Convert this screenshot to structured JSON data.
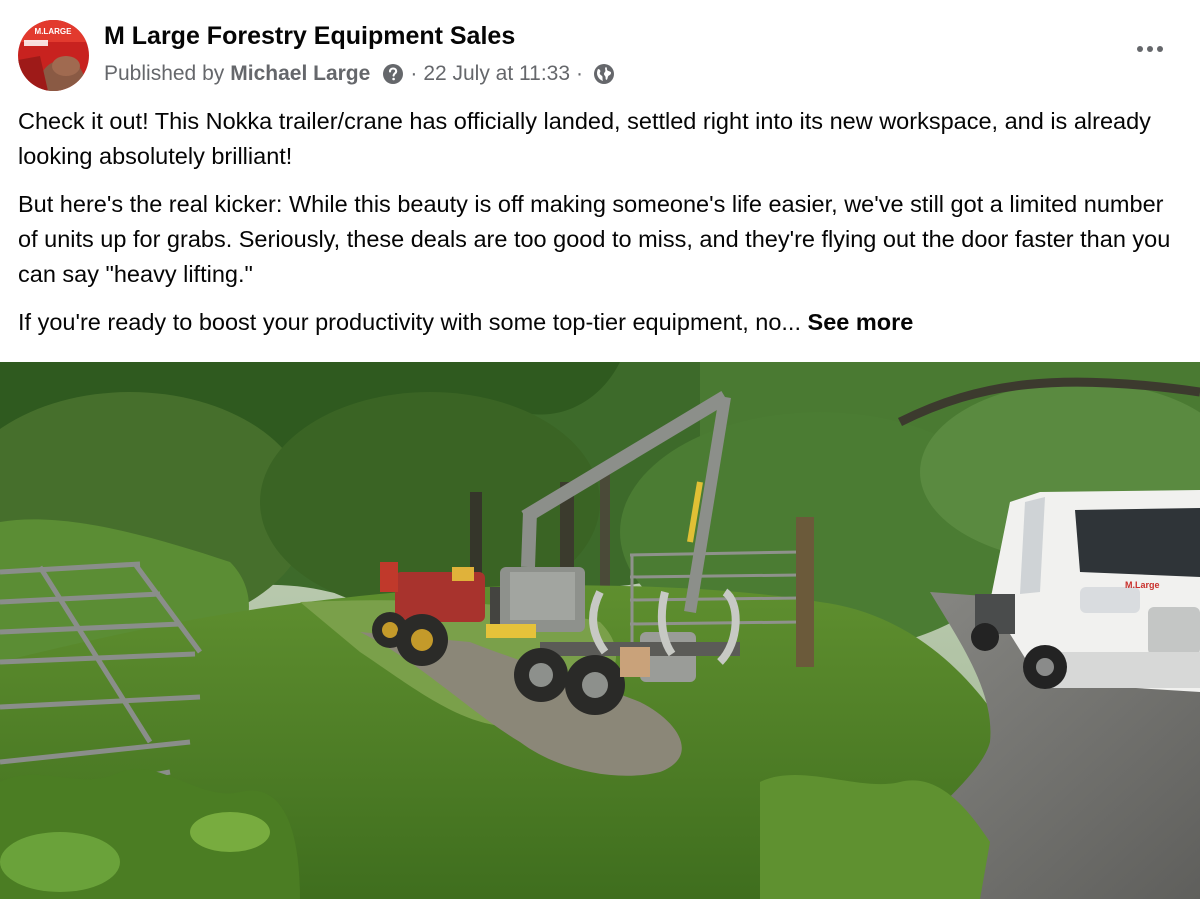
{
  "post": {
    "page_name": "M Large Forestry Equipment Sales",
    "published_prefix": "Published by",
    "author": "Michael Large",
    "separator": "·",
    "timestamp": "22 July at 11:33",
    "audience_icon": "globe-icon",
    "help_icon": "question-circle-icon",
    "more_icon": "more-horizontal-icon",
    "avatar_logo_text": "M.LARGE",
    "paragraphs": [
      "Check it out! This Nokka trailer/crane has officially landed, settled right into its new workspace, and is already looking absolutely brilliant!",
      "But here's the real kicker: While this beauty is off making someone's life easier, we've still got a limited number of units up for grabs. Seriously, these deals are too good to miss, and they're flying out the door faster than you can say \"heavy lifting.\""
    ],
    "truncated_paragraph": "If you're ready to boost your productivity with some top-tier equipment, no...",
    "see_more_label": "See more",
    "photo_subject": "tractor-with-forestry-trailer-crane-and-white-van",
    "colors": {
      "text_primary": "#050505",
      "text_secondary": "#65676b",
      "avatar_brand_red": "#c8221f"
    }
  }
}
